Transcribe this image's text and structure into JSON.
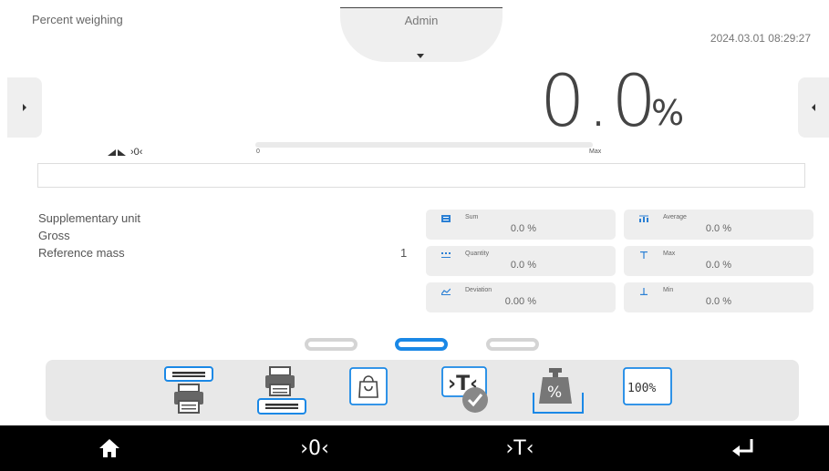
{
  "header": {
    "mode_title": "Percent weighing",
    "user": "Admin",
    "datetime": "2024.03.01 08:29:27"
  },
  "result": {
    "value": "0.0",
    "unit": "%",
    "status_zero": "›0‹"
  },
  "bargraph": {
    "min_label": "0",
    "max_label": "Max",
    "level": 0
  },
  "info": {
    "rows": [
      {
        "label": "Supplementary unit",
        "value": ""
      },
      {
        "label": "Gross",
        "value": ""
      },
      {
        "label": "Reference mass",
        "value": "1"
      }
    ]
  },
  "stats": {
    "left": [
      {
        "name": "Sum",
        "value": "0.0 %",
        "icon": "sum-icon"
      },
      {
        "name": "Quantity",
        "value": "0.0 %",
        "icon": "quantity-icon"
      },
      {
        "name": "Deviation",
        "value": "0.00 %",
        "icon": "deviation-icon"
      }
    ],
    "right": [
      {
        "name": "Average",
        "value": "0.0 %",
        "icon": "average-icon"
      },
      {
        "name": "Max",
        "value": "0.0 %",
        "icon": "max-icon"
      },
      {
        "name": "Min",
        "value": "0.0 %",
        "icon": "min-icon"
      }
    ]
  },
  "toolbar": {
    "percent_label": "100%",
    "tare_label": "›T‹",
    "weight_label": "%"
  },
  "bottombar": {
    "home": "home-icon",
    "zero": "›0‹",
    "tare": "›T‹",
    "enter": "enter-icon"
  },
  "colors": {
    "accent": "#1a88e6",
    "tile": "#eeeeee",
    "bottombar": "#000000"
  }
}
